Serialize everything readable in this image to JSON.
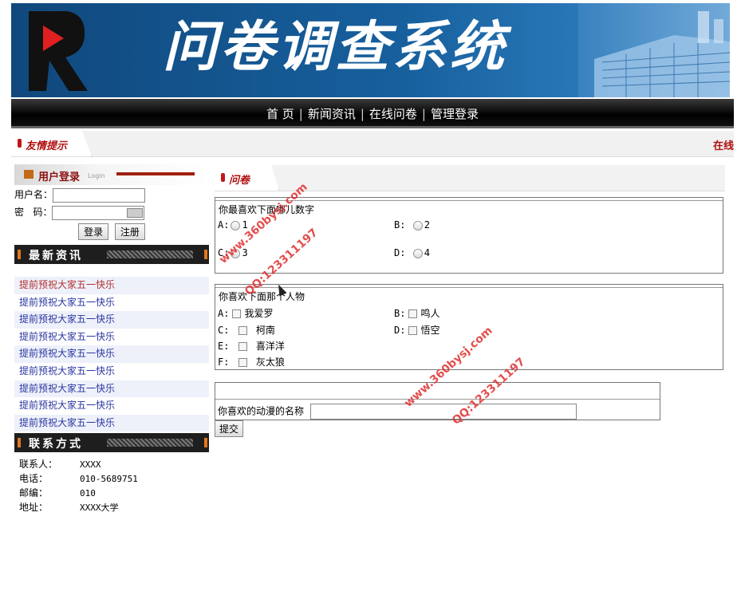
{
  "header": {
    "title": "问卷调查系统"
  },
  "nav": {
    "items": [
      "首 页",
      "新闻资讯",
      "在线问卷",
      "管理登录"
    ]
  },
  "notice": {
    "label": "友情提示",
    "marquee": "在线"
  },
  "login": {
    "heading": "用户登录",
    "heading_en": "Login",
    "username_label": "用户名：",
    "password_label": "密   码：",
    "login_button": "登录",
    "register_button": "注册"
  },
  "news": {
    "heading": "最新资讯",
    "items": [
      "提前预祝大家五一快乐",
      "提前预祝大家五一快乐",
      "提前预祝大家五一快乐",
      "提前预祝大家五一快乐",
      "提前预祝大家五一快乐",
      "提前预祝大家五一快乐",
      "提前预祝大家五一快乐",
      "提前预祝大家五一快乐",
      "提前预祝大家五一快乐"
    ]
  },
  "contact": {
    "heading": "联系方式",
    "rows": [
      {
        "k": "联系人：",
        "v": "XXXX"
      },
      {
        "k": "电话：",
        "v": "010-5689751"
      },
      {
        "k": "邮编：",
        "v": "010"
      },
      {
        "k": "地址：",
        "v": "XXXX大学"
      }
    ]
  },
  "survey": {
    "tab_label": "问卷",
    "q1": {
      "title": "你最喜欢下面哪儿数字",
      "options": [
        {
          "key": "A:",
          "text": "1"
        },
        {
          "key": "B:",
          "text": "2"
        },
        {
          "key": "C:",
          "text": "3"
        },
        {
          "key": "D:",
          "text": "4"
        }
      ]
    },
    "q2": {
      "title": "你喜欢下面那个人物",
      "options": [
        {
          "key": "A:",
          "text": "我爱罗"
        },
        {
          "key": "B:",
          "text": "鸣人"
        },
        {
          "key": "C:",
          "text": "柯南"
        },
        {
          "key": "D:",
          "text": "悟空"
        },
        {
          "key": "E:",
          "text": "喜洋洋"
        },
        {
          "key": "F:",
          "text": "灰太狼"
        }
      ]
    },
    "q3": {
      "label": "你喜欢的动漫的名称",
      "value": ""
    },
    "submit": "提交"
  },
  "watermarks": [
    "www.360bysj.com",
    "QQ:123311197",
    "www.360bysj.com",
    "QQ:123311197"
  ]
}
